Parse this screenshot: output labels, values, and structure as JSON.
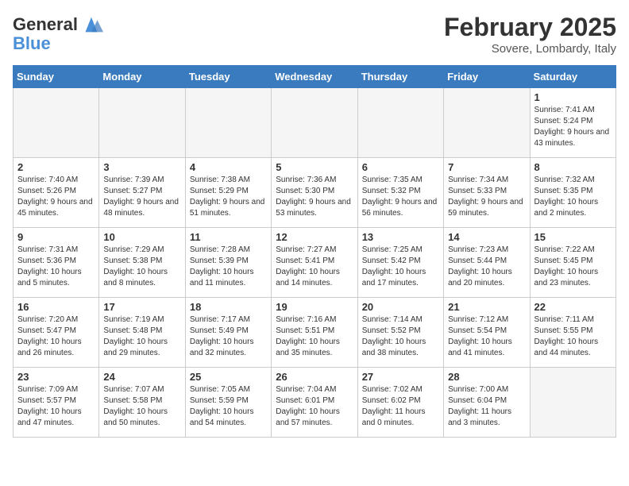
{
  "header": {
    "logo_general": "General",
    "logo_blue": "Blue",
    "month": "February 2025",
    "location": "Sovere, Lombardy, Italy"
  },
  "days_of_week": [
    "Sunday",
    "Monday",
    "Tuesday",
    "Wednesday",
    "Thursday",
    "Friday",
    "Saturday"
  ],
  "weeks": [
    [
      {
        "day": "",
        "info": "",
        "empty": true
      },
      {
        "day": "",
        "info": "",
        "empty": true
      },
      {
        "day": "",
        "info": "",
        "empty": true
      },
      {
        "day": "",
        "info": "",
        "empty": true
      },
      {
        "day": "",
        "info": "",
        "empty": true
      },
      {
        "day": "",
        "info": "",
        "empty": true
      },
      {
        "day": "1",
        "info": "Sunrise: 7:41 AM\nSunset: 5:24 PM\nDaylight: 9 hours and 43 minutes."
      }
    ],
    [
      {
        "day": "2",
        "info": "Sunrise: 7:40 AM\nSunset: 5:26 PM\nDaylight: 9 hours and 45 minutes."
      },
      {
        "day": "3",
        "info": "Sunrise: 7:39 AM\nSunset: 5:27 PM\nDaylight: 9 hours and 48 minutes."
      },
      {
        "day": "4",
        "info": "Sunrise: 7:38 AM\nSunset: 5:29 PM\nDaylight: 9 hours and 51 minutes."
      },
      {
        "day": "5",
        "info": "Sunrise: 7:36 AM\nSunset: 5:30 PM\nDaylight: 9 hours and 53 minutes."
      },
      {
        "day": "6",
        "info": "Sunrise: 7:35 AM\nSunset: 5:32 PM\nDaylight: 9 hours and 56 minutes."
      },
      {
        "day": "7",
        "info": "Sunrise: 7:34 AM\nSunset: 5:33 PM\nDaylight: 9 hours and 59 minutes."
      },
      {
        "day": "8",
        "info": "Sunrise: 7:32 AM\nSunset: 5:35 PM\nDaylight: 10 hours and 2 minutes."
      }
    ],
    [
      {
        "day": "9",
        "info": "Sunrise: 7:31 AM\nSunset: 5:36 PM\nDaylight: 10 hours and 5 minutes."
      },
      {
        "day": "10",
        "info": "Sunrise: 7:29 AM\nSunset: 5:38 PM\nDaylight: 10 hours and 8 minutes."
      },
      {
        "day": "11",
        "info": "Sunrise: 7:28 AM\nSunset: 5:39 PM\nDaylight: 10 hours and 11 minutes."
      },
      {
        "day": "12",
        "info": "Sunrise: 7:27 AM\nSunset: 5:41 PM\nDaylight: 10 hours and 14 minutes."
      },
      {
        "day": "13",
        "info": "Sunrise: 7:25 AM\nSunset: 5:42 PM\nDaylight: 10 hours and 17 minutes."
      },
      {
        "day": "14",
        "info": "Sunrise: 7:23 AM\nSunset: 5:44 PM\nDaylight: 10 hours and 20 minutes."
      },
      {
        "day": "15",
        "info": "Sunrise: 7:22 AM\nSunset: 5:45 PM\nDaylight: 10 hours and 23 minutes."
      }
    ],
    [
      {
        "day": "16",
        "info": "Sunrise: 7:20 AM\nSunset: 5:47 PM\nDaylight: 10 hours and 26 minutes."
      },
      {
        "day": "17",
        "info": "Sunrise: 7:19 AM\nSunset: 5:48 PM\nDaylight: 10 hours and 29 minutes."
      },
      {
        "day": "18",
        "info": "Sunrise: 7:17 AM\nSunset: 5:49 PM\nDaylight: 10 hours and 32 minutes."
      },
      {
        "day": "19",
        "info": "Sunrise: 7:16 AM\nSunset: 5:51 PM\nDaylight: 10 hours and 35 minutes."
      },
      {
        "day": "20",
        "info": "Sunrise: 7:14 AM\nSunset: 5:52 PM\nDaylight: 10 hours and 38 minutes."
      },
      {
        "day": "21",
        "info": "Sunrise: 7:12 AM\nSunset: 5:54 PM\nDaylight: 10 hours and 41 minutes."
      },
      {
        "day": "22",
        "info": "Sunrise: 7:11 AM\nSunset: 5:55 PM\nDaylight: 10 hours and 44 minutes."
      }
    ],
    [
      {
        "day": "23",
        "info": "Sunrise: 7:09 AM\nSunset: 5:57 PM\nDaylight: 10 hours and 47 minutes."
      },
      {
        "day": "24",
        "info": "Sunrise: 7:07 AM\nSunset: 5:58 PM\nDaylight: 10 hours and 50 minutes."
      },
      {
        "day": "25",
        "info": "Sunrise: 7:05 AM\nSunset: 5:59 PM\nDaylight: 10 hours and 54 minutes."
      },
      {
        "day": "26",
        "info": "Sunrise: 7:04 AM\nSunset: 6:01 PM\nDaylight: 10 hours and 57 minutes."
      },
      {
        "day": "27",
        "info": "Sunrise: 7:02 AM\nSunset: 6:02 PM\nDaylight: 11 hours and 0 minutes."
      },
      {
        "day": "28",
        "info": "Sunrise: 7:00 AM\nSunset: 6:04 PM\nDaylight: 11 hours and 3 minutes."
      },
      {
        "day": "",
        "info": "",
        "empty": true
      }
    ]
  ]
}
